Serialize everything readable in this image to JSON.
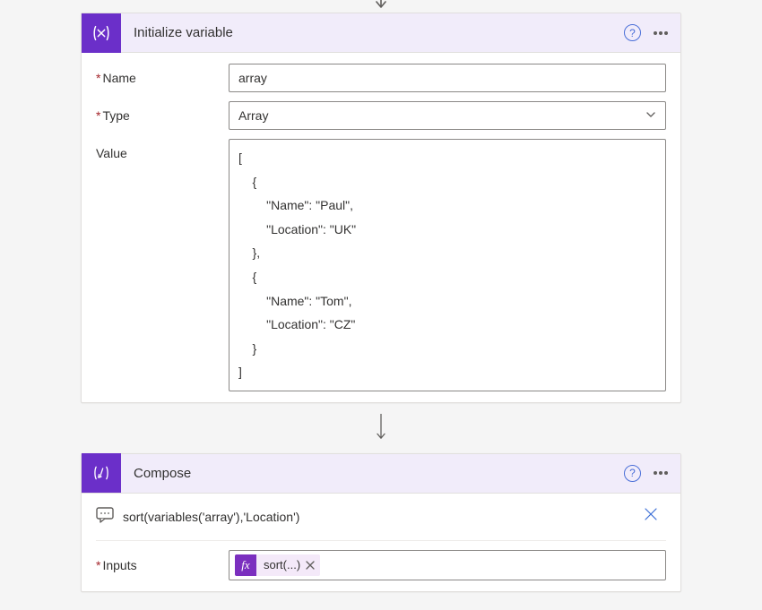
{
  "cards": {
    "initVar": {
      "title": "Initialize variable",
      "fields": {
        "name": {
          "label": "Name",
          "required": true,
          "value": "array"
        },
        "type": {
          "label": "Type",
          "required": true,
          "value": "Array"
        },
        "value": {
          "label": "Value",
          "required": false,
          "content": "[\n    {\n        \"Name\": \"Paul\",\n        \"Location\": \"UK\"\n    },\n    {\n        \"Name\": \"Tom\",\n        \"Location\": \"CZ\"\n    }\n]"
        }
      }
    },
    "compose": {
      "title": "Compose",
      "hint": "sort(variables('array'),'Location')",
      "inputs": {
        "label": "Inputs",
        "required": true,
        "token": {
          "badge": "fx",
          "text": "sort(...)"
        }
      }
    }
  },
  "icons": {
    "help": "?",
    "close_x": "✕",
    "token_remove": "✕"
  }
}
